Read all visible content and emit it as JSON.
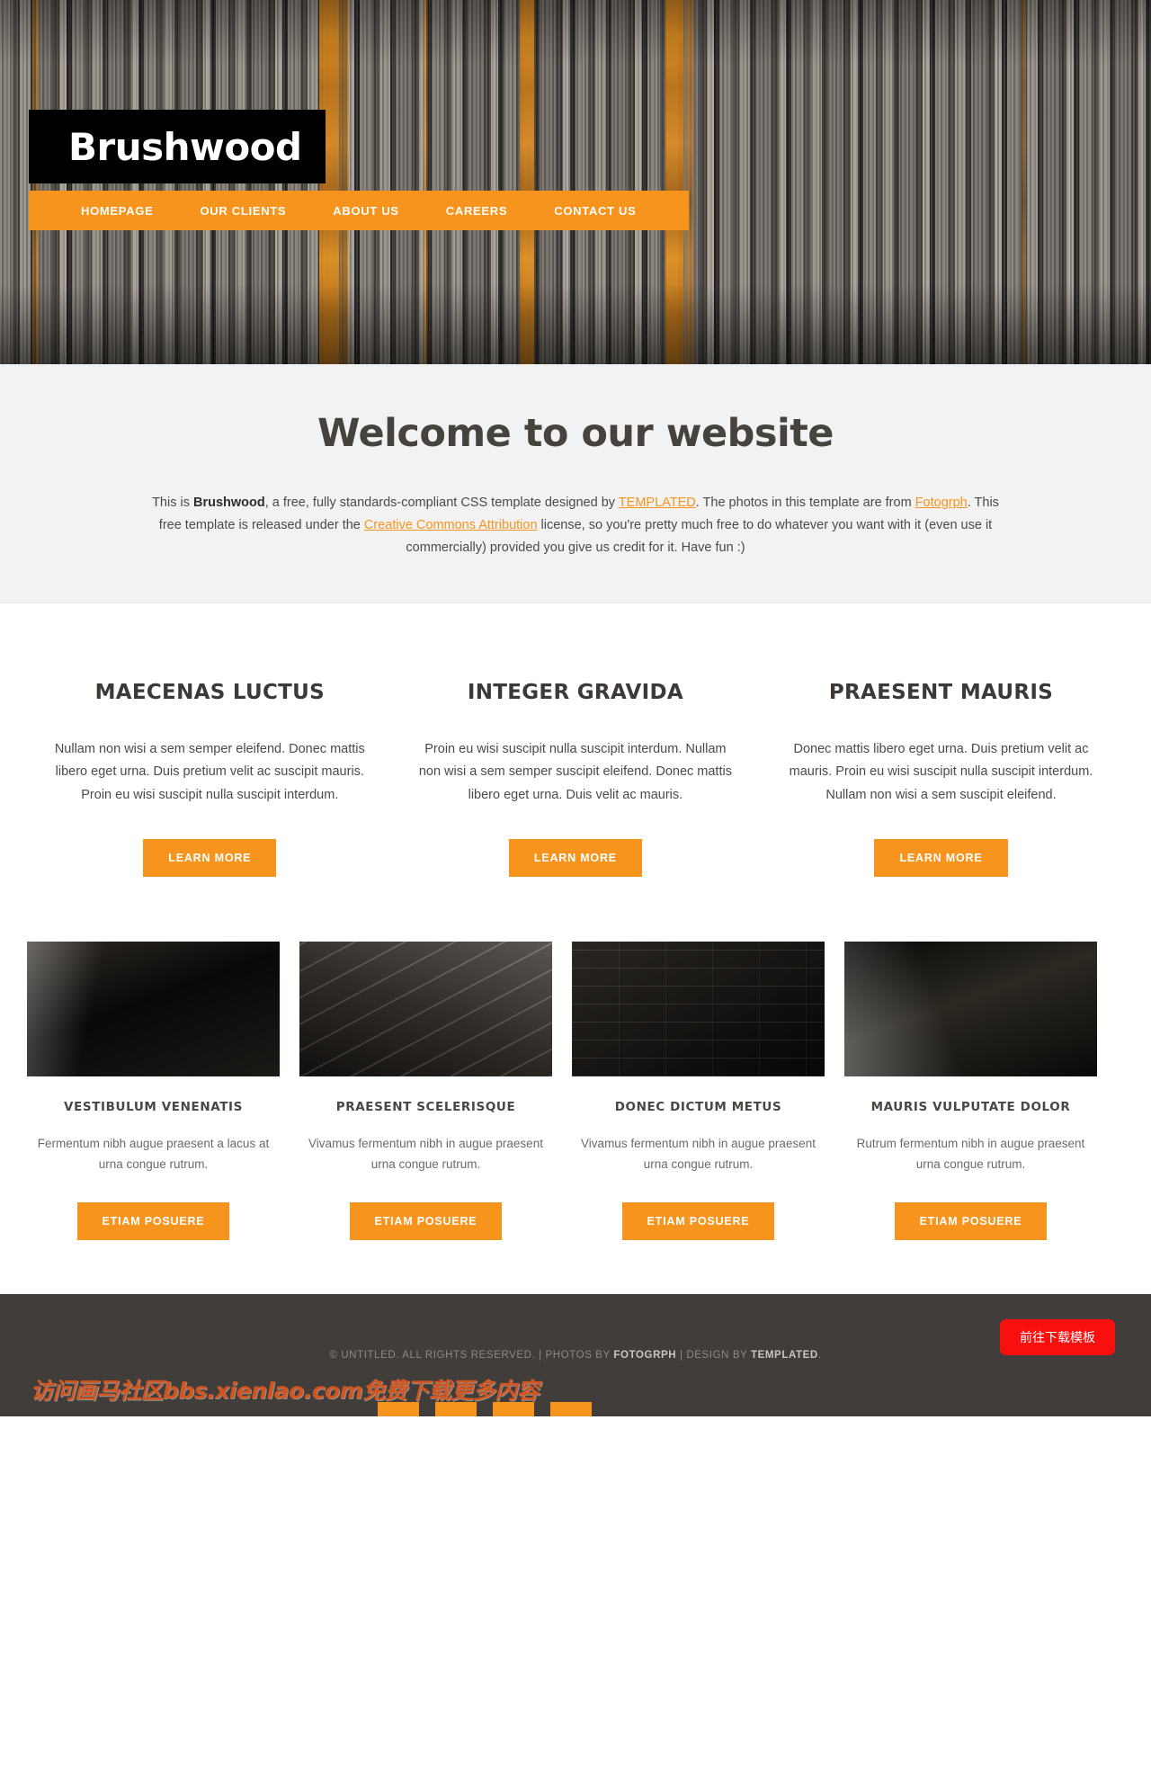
{
  "header": {
    "logo": "Brushwood",
    "nav": [
      {
        "label": "HOMEPAGE"
      },
      {
        "label": "OUR CLIENTS"
      },
      {
        "label": "ABOUT US"
      },
      {
        "label": "CAREERS"
      },
      {
        "label": "CONTACT US"
      }
    ],
    "accent_color": "#f7941d",
    "logo_background": "#000000"
  },
  "welcome": {
    "title": "Welcome to our website",
    "intro_1": "This is ",
    "brand": "Brushwood",
    "intro_2": ", a free, fully standards-compliant CSS template designed by ",
    "link_templated": "TEMPLATED",
    "intro_3": ". The photos in this template are from ",
    "link_fotogrph": "Fotogrph",
    "intro_4": ". This free template is released under the ",
    "link_cc": "Creative Commons Attribution",
    "intro_5": " license, so you're pretty much free to do whatever you want with it (even use it commercially) provided you give us credit for it. Have fun :)"
  },
  "boxes": [
    {
      "title": "MAECENAS LUCTUS",
      "body": "Nullam non wisi a sem semper eleifend. Donec mattis libero eget urna. Duis pretium velit ac suscipit mauris. Proin eu wisi suscipit nulla suscipit interdum.",
      "button": "LEARN MORE"
    },
    {
      "title": "INTEGER GRAVIDA",
      "body": "Proin eu wisi suscipit nulla suscipit interdum. Nullam non wisi a sem semper suscipit eleifend. Donec mattis libero eget urna. Duis velit ac mauris.",
      "button": "LEARN MORE"
    },
    {
      "title": "PRAESENT MAURIS",
      "body": "Donec mattis libero eget urna. Duis pretium velit ac mauris. Proin eu wisi suscipit nulla suscipit interdum. Nullam non wisi a sem suscipit eleifend.",
      "button": "LEARN MORE"
    }
  ],
  "gallery": [
    {
      "image_name": "dark-wall-beam-photo",
      "title": "VESTIBULUM VENENATIS",
      "body": "Fermentum nibh augue praesent a lacus at urna congue rutrum.",
      "button": "ETIAM POSUERE"
    },
    {
      "image_name": "stone-wall-angle-photo",
      "title": "PRAESENT SCELERISQUE",
      "body": "Vivamus fermentum nibh in augue praesent urna congue rutrum.",
      "button": "ETIAM POSUERE"
    },
    {
      "image_name": "brick-wall-dark-photo",
      "title": "DONEC DICTUM METUS",
      "body": "Vivamus fermentum nibh in augue praesent urna congue rutrum.",
      "button": "ETIAM POSUERE"
    },
    {
      "image_name": "wooden-beams-shadow-photo",
      "title": "MAURIS VULPUTATE DOLOR",
      "body": "Rutrum fermentum nibh in augue praesent urna congue rutrum.",
      "button": "ETIAM POSUERE"
    }
  ],
  "footer": {
    "copyright_1": "© UNTITLED. ALL RIGHTS RESERVED. | PHOTOS BY ",
    "photos_by": "FOTOGRPH",
    "copyright_2": " | DESIGN BY ",
    "design_by": "TEMPLATED",
    "copyright_3": ".",
    "download_button": "前往下载模板",
    "download_button_color": "#fa0f0f",
    "watermark": "访问画马社区bbs.xienlao.com免费下载更多内容",
    "background_color": "#403d3a"
  }
}
